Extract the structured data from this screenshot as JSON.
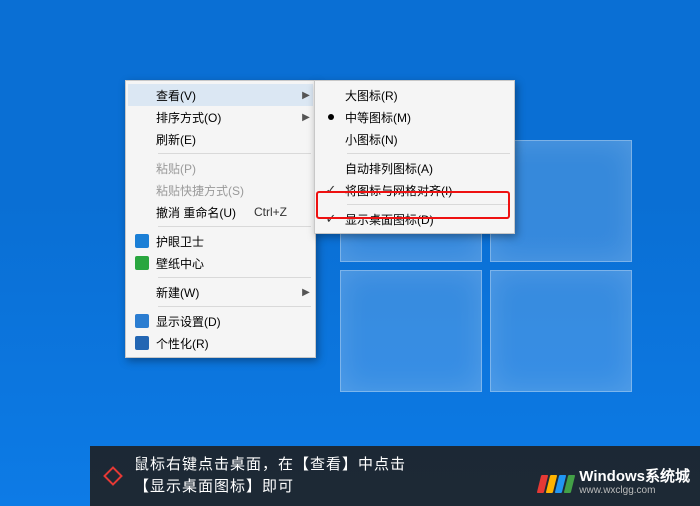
{
  "menu1": {
    "view": {
      "label": "查看(V)"
    },
    "sort": {
      "label": "排序方式(O)"
    },
    "refresh": {
      "label": "刷新(E)"
    },
    "paste": {
      "label": "粘贴(P)"
    },
    "pasteShort": {
      "label": "粘贴快捷方式(S)"
    },
    "undoRename": {
      "label": "撤消 重命名(U)",
      "accel": "Ctrl+Z"
    },
    "huyan": {
      "label": "护眼卫士"
    },
    "wallpaper": {
      "label": "壁纸中心"
    },
    "new": {
      "label": "新建(W)"
    },
    "display": {
      "label": "显示设置(D)"
    },
    "personalize": {
      "label": "个性化(R)"
    }
  },
  "menu2": {
    "large": {
      "label": "大图标(R)"
    },
    "medium": {
      "label": "中等图标(M)"
    },
    "small": {
      "label": "小图标(N)"
    },
    "auto": {
      "label": "自动排列图标(A)"
    },
    "align": {
      "label": "将图标与网格对齐(I)"
    },
    "show": {
      "label": "显示桌面图标(D)"
    }
  },
  "caption": {
    "line1": "鼠标右键点击桌面，在【查看】中点击",
    "line2": "【显示桌面图标】即可"
  },
  "brand": {
    "name": "Windows系统城",
    "url": "www.wxclgg.com"
  }
}
